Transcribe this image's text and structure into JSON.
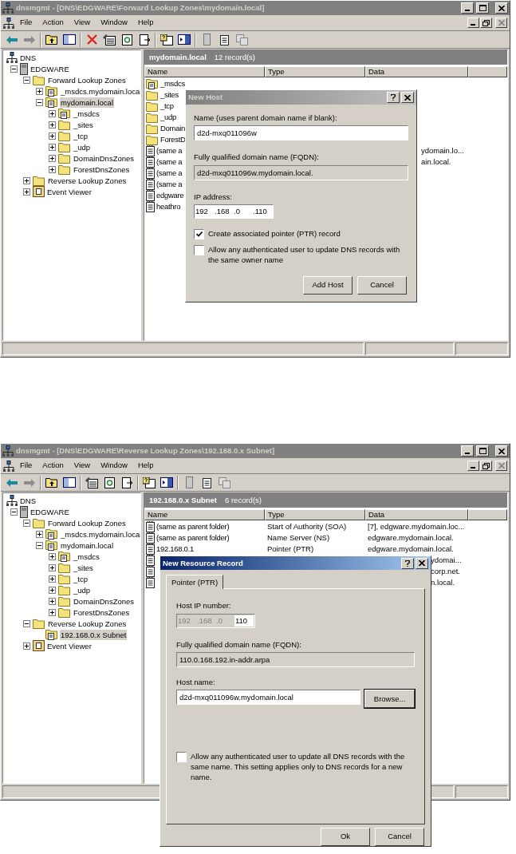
{
  "windows": [
    {
      "title": "dnsmgmt - [DNS\\EDGWARE\\Forward Lookup Zones\\mydomain.local]",
      "active": false,
      "menu": [
        "File",
        "Action",
        "View",
        "Window",
        "Help"
      ],
      "toolbar": {
        "delete_button": true
      },
      "tree": [
        {
          "label": "DNS",
          "kind": "dns",
          "selected": false,
          "children": [
            {
              "label": "EDGWARE",
              "kind": "server",
              "expanded": true,
              "selected": false,
              "children": [
                {
                  "label": "Forward Lookup Zones",
                  "kind": "folder",
                  "expanded": true,
                  "selected": false,
                  "children": [
                    {
                      "label": "_msdcs.mydomain.local",
                      "kind": "zone",
                      "expanded": false,
                      "selected": false
                    },
                    {
                      "label": "mydomain.local",
                      "kind": "zone",
                      "expanded": true,
                      "selected": true,
                      "children": [
                        {
                          "label": "_msdcs",
                          "kind": "zone",
                          "expanded": false,
                          "selected": false
                        },
                        {
                          "label": "_sites",
                          "kind": "folder",
                          "expanded": false,
                          "selected": false
                        },
                        {
                          "label": "_tcp",
                          "kind": "folder",
                          "expanded": false,
                          "selected": false
                        },
                        {
                          "label": "_udp",
                          "kind": "folder",
                          "expanded": false,
                          "selected": false
                        },
                        {
                          "label": "DomainDnsZones",
                          "kind": "folder",
                          "expanded": false,
                          "selected": false
                        },
                        {
                          "label": "ForestDnsZones",
                          "kind": "folder",
                          "expanded": false,
                          "selected": false
                        }
                      ]
                    }
                  ]
                },
                {
                  "label": "Reverse Lookup Zones",
                  "kind": "folder",
                  "expanded": false,
                  "selected": false
                },
                {
                  "label": "Event Viewer",
                  "kind": "event",
                  "expanded": false,
                  "selected": false
                }
              ]
            }
          ]
        }
      ],
      "list": {
        "title": "mydomain.local",
        "count": "12 record(s)",
        "columns": [
          "Name",
          "Type",
          "Data"
        ],
        "rows": [
          {
            "kind": "zone",
            "name": "_msdcs"
          },
          {
            "kind": "folder",
            "name": "_sites"
          },
          {
            "kind": "folder",
            "name": "_tcp"
          },
          {
            "kind": "folder",
            "name": "_udp"
          },
          {
            "kind": "folder",
            "name": "Domain"
          },
          {
            "kind": "folder",
            "name": "ForestD"
          },
          {
            "kind": "record",
            "name": "(same a",
            "data": "ydomain.lo...",
            "data_covered": true
          },
          {
            "kind": "record",
            "name": "(same a",
            "data": "ain.local.",
            "data_covered": true
          },
          {
            "kind": "record",
            "name": "(same a"
          },
          {
            "kind": "record",
            "name": "(same a"
          },
          {
            "kind": "record",
            "name": "edgware"
          },
          {
            "kind": "record",
            "name": "heathro"
          }
        ]
      },
      "dialog": {
        "kind": "new_host",
        "title": "New Host",
        "active": false,
        "name_label": "Name (uses parent domain name if blank):",
        "name_value": "d2d-mxq011096w",
        "fqdn_label": "Fully qualified domain name (FQDN):",
        "fqdn_value": "d2d-mxq011096w.mydomain.local.",
        "ip_label": "IP address:",
        "ip": [
          {
            "value": "192",
            "disabled": false
          },
          {
            "value": ".168",
            "disabled": false
          },
          {
            "value": ".0",
            "disabled": false
          },
          {
            "value": ".110",
            "disabled": false
          }
        ],
        "checkboxes": [
          {
            "label": "Create associated pointer (PTR) record",
            "checked": true
          },
          {
            "label": "Allow any authenticated user to update DNS records with the same owner name",
            "checked": false
          }
        ],
        "buttons": [
          "Add Host",
          "Cancel"
        ]
      }
    },
    {
      "title": "dnsmgmt - [DNS\\EDGWARE\\Reverse Lookup Zones\\192.168.0.x Subnet]",
      "active": false,
      "menu": [
        "File",
        "Action",
        "View",
        "Window",
        "Help"
      ],
      "toolbar": {
        "delete_button": false
      },
      "tree": [
        {
          "label": "DNS",
          "kind": "dns",
          "selected": false,
          "children": [
            {
              "label": "EDGWARE",
              "kind": "server",
              "expanded": true,
              "selected": false,
              "children": [
                {
                  "label": "Forward Lookup Zones",
                  "kind": "folder",
                  "expanded": true,
                  "selected": false,
                  "children": [
                    {
                      "label": "_msdcs.mydomain.local",
                      "kind": "zone",
                      "expanded": false,
                      "selected": false
                    },
                    {
                      "label": "mydomain.local",
                      "kind": "zone",
                      "expanded": true,
                      "selected": false,
                      "children": [
                        {
                          "label": "_msdcs",
                          "kind": "zone",
                          "expanded": false,
                          "selected": false
                        },
                        {
                          "label": "_sites",
                          "kind": "folder",
                          "expanded": false,
                          "selected": false
                        },
                        {
                          "label": "_tcp",
                          "kind": "folder",
                          "expanded": false,
                          "selected": false
                        },
                        {
                          "label": "_udp",
                          "kind": "folder",
                          "expanded": false,
                          "selected": false
                        },
                        {
                          "label": "DomainDnsZones",
                          "kind": "folder",
                          "expanded": false,
                          "selected": false
                        },
                        {
                          "label": "ForestDnsZones",
                          "kind": "folder",
                          "expanded": false,
                          "selected": false
                        }
                      ]
                    }
                  ]
                },
                {
                  "label": "Reverse Lookup Zones",
                  "kind": "folder",
                  "expanded": true,
                  "selected": false,
                  "children": [
                    {
                      "label": "192.168.0.x Subnet",
                      "kind": "zone",
                      "selected": true
                    }
                  ]
                },
                {
                  "label": "Event Viewer",
                  "kind": "event",
                  "expanded": false,
                  "selected": false
                }
              ]
            }
          ]
        }
      ],
      "list": {
        "title": "192.168.0.x Subnet",
        "count": "6 record(s)",
        "columns": [
          "Name",
          "Type",
          "Data"
        ],
        "rows": [
          {
            "kind": "record",
            "name": "(same as parent folder)",
            "type": "Start of Authority (SOA)",
            "data": "[7], edgware.mydomain.loc..."
          },
          {
            "kind": "record",
            "name": "(same as parent folder)",
            "type": "Name Server (NS)",
            "data": "edgware.mydomain.local."
          },
          {
            "kind": "record",
            "name": "192.168.0.1",
            "type": "Pointer (PTR)",
            "data": "edgware.mydomain.local."
          },
          {
            "kind": "record",
            "data": "ydomai...",
            "data_covered": true
          },
          {
            "kind": "record",
            "data": "corp.net.",
            "data_covered": true
          },
          {
            "kind": "record",
            "data": "n.local.",
            "data_covered": true
          }
        ]
      },
      "dialog": {
        "kind": "resource_record",
        "title": "New Resource Record",
        "active": true,
        "tabs": [
          {
            "label": "Pointer (PTR)",
            "selected": true
          }
        ],
        "ip_label": "Host IP number:",
        "ip": [
          {
            "value": "192",
            "disabled": true
          },
          {
            "value": ".168",
            "disabled": true
          },
          {
            "value": ".0",
            "disabled": true
          },
          {
            "value": "110",
            "disabled": false
          }
        ],
        "fqdn_label": "Fully qualified domain name (FQDN):",
        "fqdn_value": "110.0.168.192.in-addr.arpa",
        "host_label": "Host name:",
        "host_value": "d2d-mxq011096w.mydomain.local",
        "browse": "Browse...",
        "checkboxes": [
          {
            "label": "Allow any authenticated user to update all DNS records with the same name. This setting applies only to DNS records for a new name.",
            "checked": false
          }
        ],
        "buttons": [
          "Ok",
          "Cancel"
        ]
      }
    }
  ]
}
